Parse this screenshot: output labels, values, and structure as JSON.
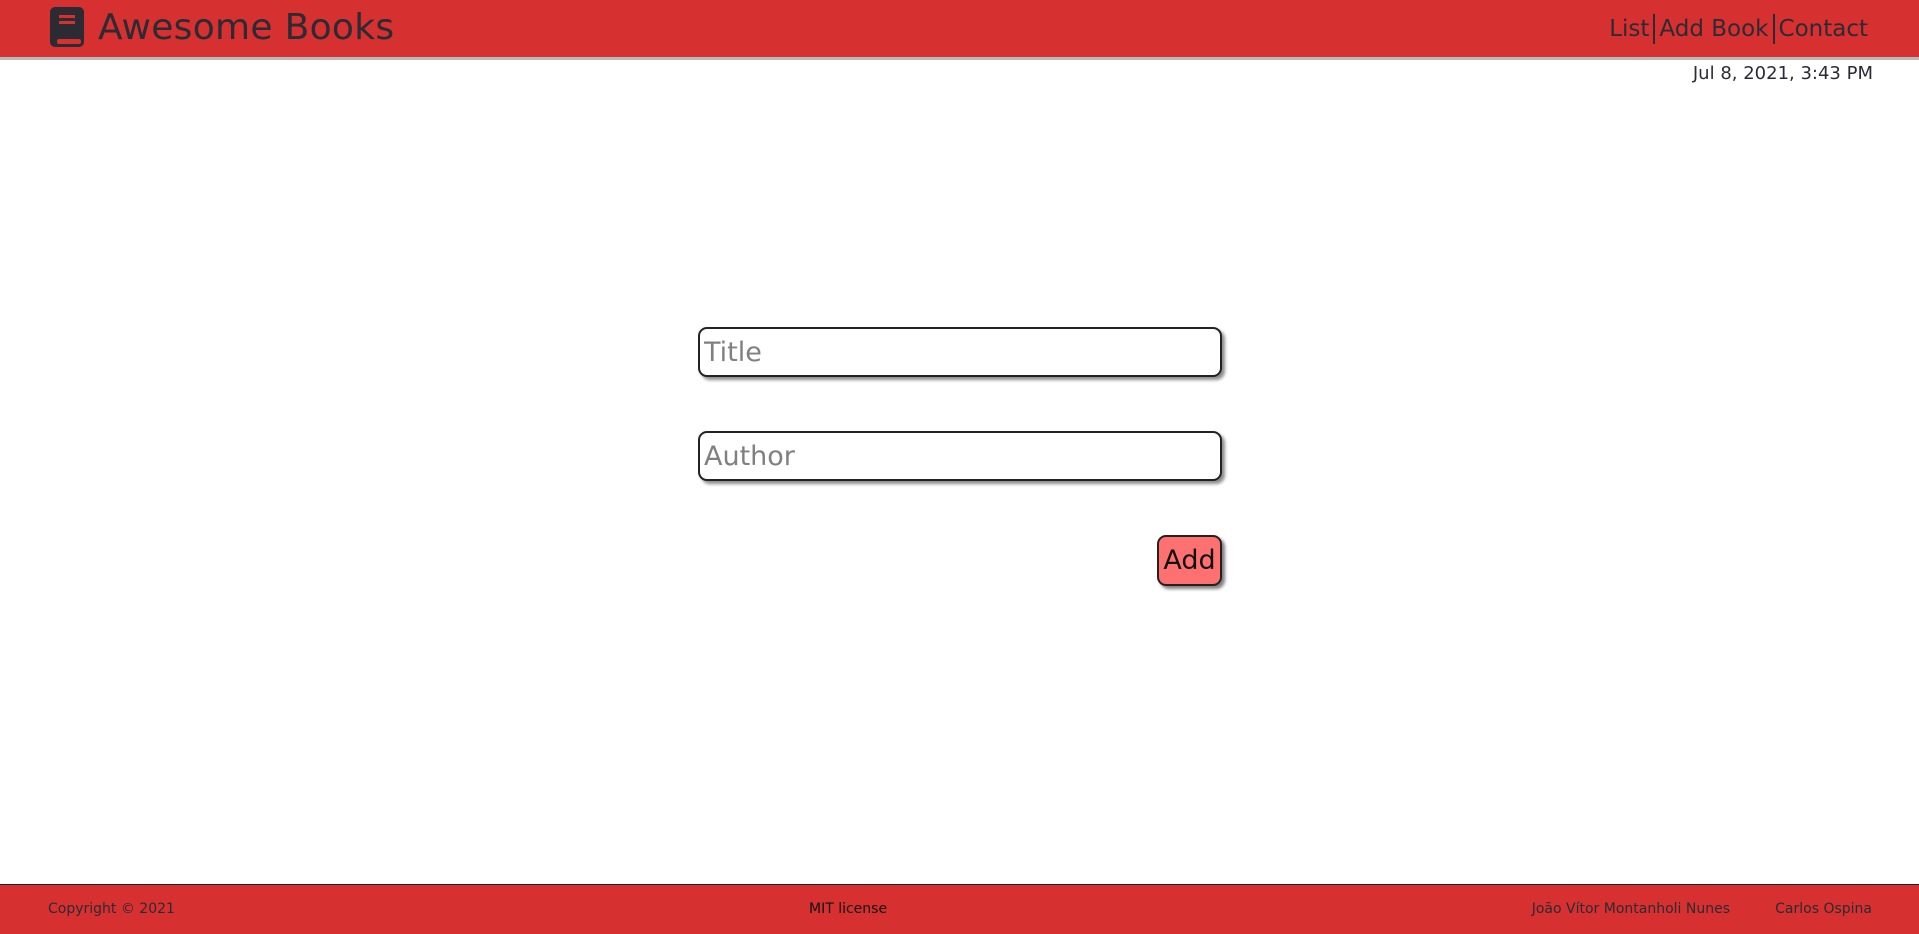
{
  "header": {
    "brand": "Awesome Books",
    "logo_icon": "book-icon",
    "nav": {
      "list": "List",
      "add_book": "Add Book",
      "contact": "Contact"
    }
  },
  "date": "Jul 8, 2021, 3:43 PM",
  "form": {
    "title_placeholder": "Title",
    "author_placeholder": "Author",
    "add_label": "Add"
  },
  "footer": {
    "copyright": "Copyright © 2021",
    "license": "MIT license",
    "authors": [
      "João Vítor Montanholi Nunes",
      "Carlos Ospina"
    ]
  },
  "colors": {
    "accent": "#d73030",
    "button": "#ff7070",
    "text": "#2b2b33"
  }
}
